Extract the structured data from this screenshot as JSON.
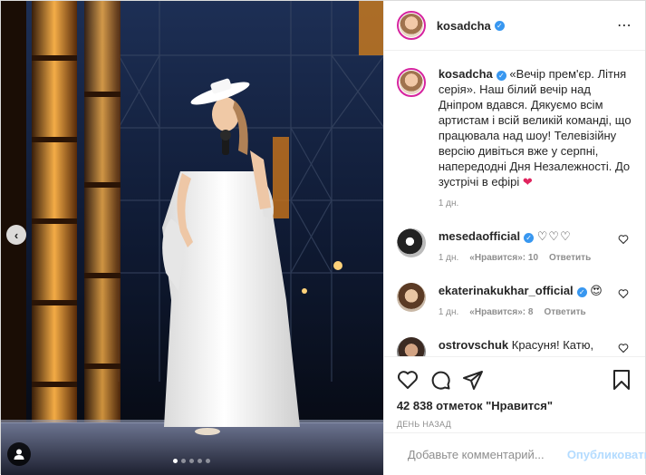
{
  "post": {
    "author": "kosadcha",
    "more_icon": "⋯",
    "caption": {
      "author": "kosadcha",
      "text": "«Вечір прем'єр. Літня серія». Наш білий вечір над Дніпром вдався. Дякуємо всім артистам і всій великій команді, що працювала над шоу! Телевізійну версію дивіться вже у серпні, напередодні Дня Незалежності. До зустрічі в ефірі",
      "emoji": "❤",
      "time": "1 дн."
    },
    "comments": [
      {
        "user": "mesedaofficial",
        "text": "♡♡♡",
        "time": "1 дн.",
        "likes": "«Нравится»: 10",
        "reply": "Ответить"
      },
      {
        "user": "ekaterinakukhar_official",
        "text": "😍",
        "time": "1 дн.",
        "likes": "«Нравится»: 8",
        "reply": "Ответить"
      },
      {
        "user": "ostrovschuk",
        "text": "Красуня! Катю, захоплююсь вами!",
        "time": "",
        "likes": "",
        "reply": ""
      }
    ],
    "likes_text": "42 838 отметок \"Нравится\"",
    "date_text": "ДЕНЬ НАЗАД",
    "add_comment_placeholder": "Добавьте комментарий...",
    "publish_label": "Опубликовать",
    "media": {
      "prev_arrow": "‹",
      "carousel_total": 5,
      "carousel_active": 1
    }
  },
  "icons": {
    "verified": "verified-badge-icon",
    "like": "heart-icon",
    "comment": "comment-icon",
    "share": "share-icon",
    "save": "bookmark-icon",
    "emoji": "smiley-icon",
    "tag": "user-tag-icon"
  },
  "colors": {
    "accent": "#3897f0",
    "publish_disabled": "#b3dbff",
    "muted": "#8e8e8e",
    "heart": "#e0245e"
  }
}
